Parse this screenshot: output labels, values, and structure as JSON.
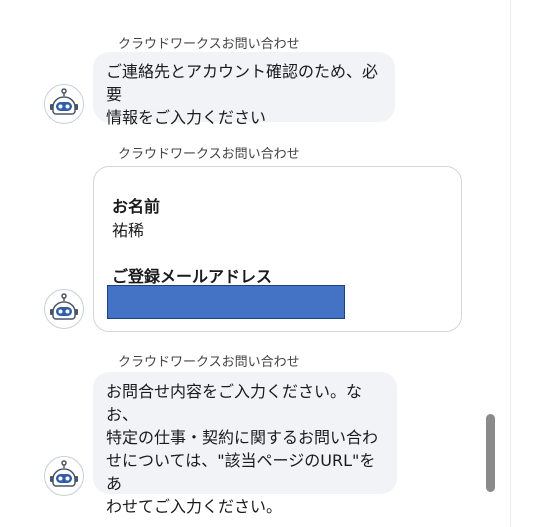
{
  "colors": {
    "bubble_bg": "#f1f3f6",
    "card_border": "#d3d6db",
    "redaction": "#4472c4",
    "scrollbar_thumb": "#8a8a8a"
  },
  "messages": [
    {
      "sender": "クラウドワークスお問い合わせ",
      "lines": [
        "ご連絡先とアカウント確認のため、必要",
        "情報をご入力ください"
      ]
    },
    {
      "sender": "クラウドワークスお問い合わせ",
      "card": {
        "name_label": "お名前",
        "name_value": "祐稀",
        "email_label": "ご登録メールアドレス"
      }
    },
    {
      "sender": "クラウドワークスお問い合わせ",
      "lines": [
        "お問合せ内容をご入力ください。なお、",
        "特定の仕事・契約に関するお問い合わ",
        "せについては、\"該当ページのURL\"をあ",
        "わせてご入力ください。"
      ]
    }
  ],
  "avatar_icon": "robot-icon"
}
